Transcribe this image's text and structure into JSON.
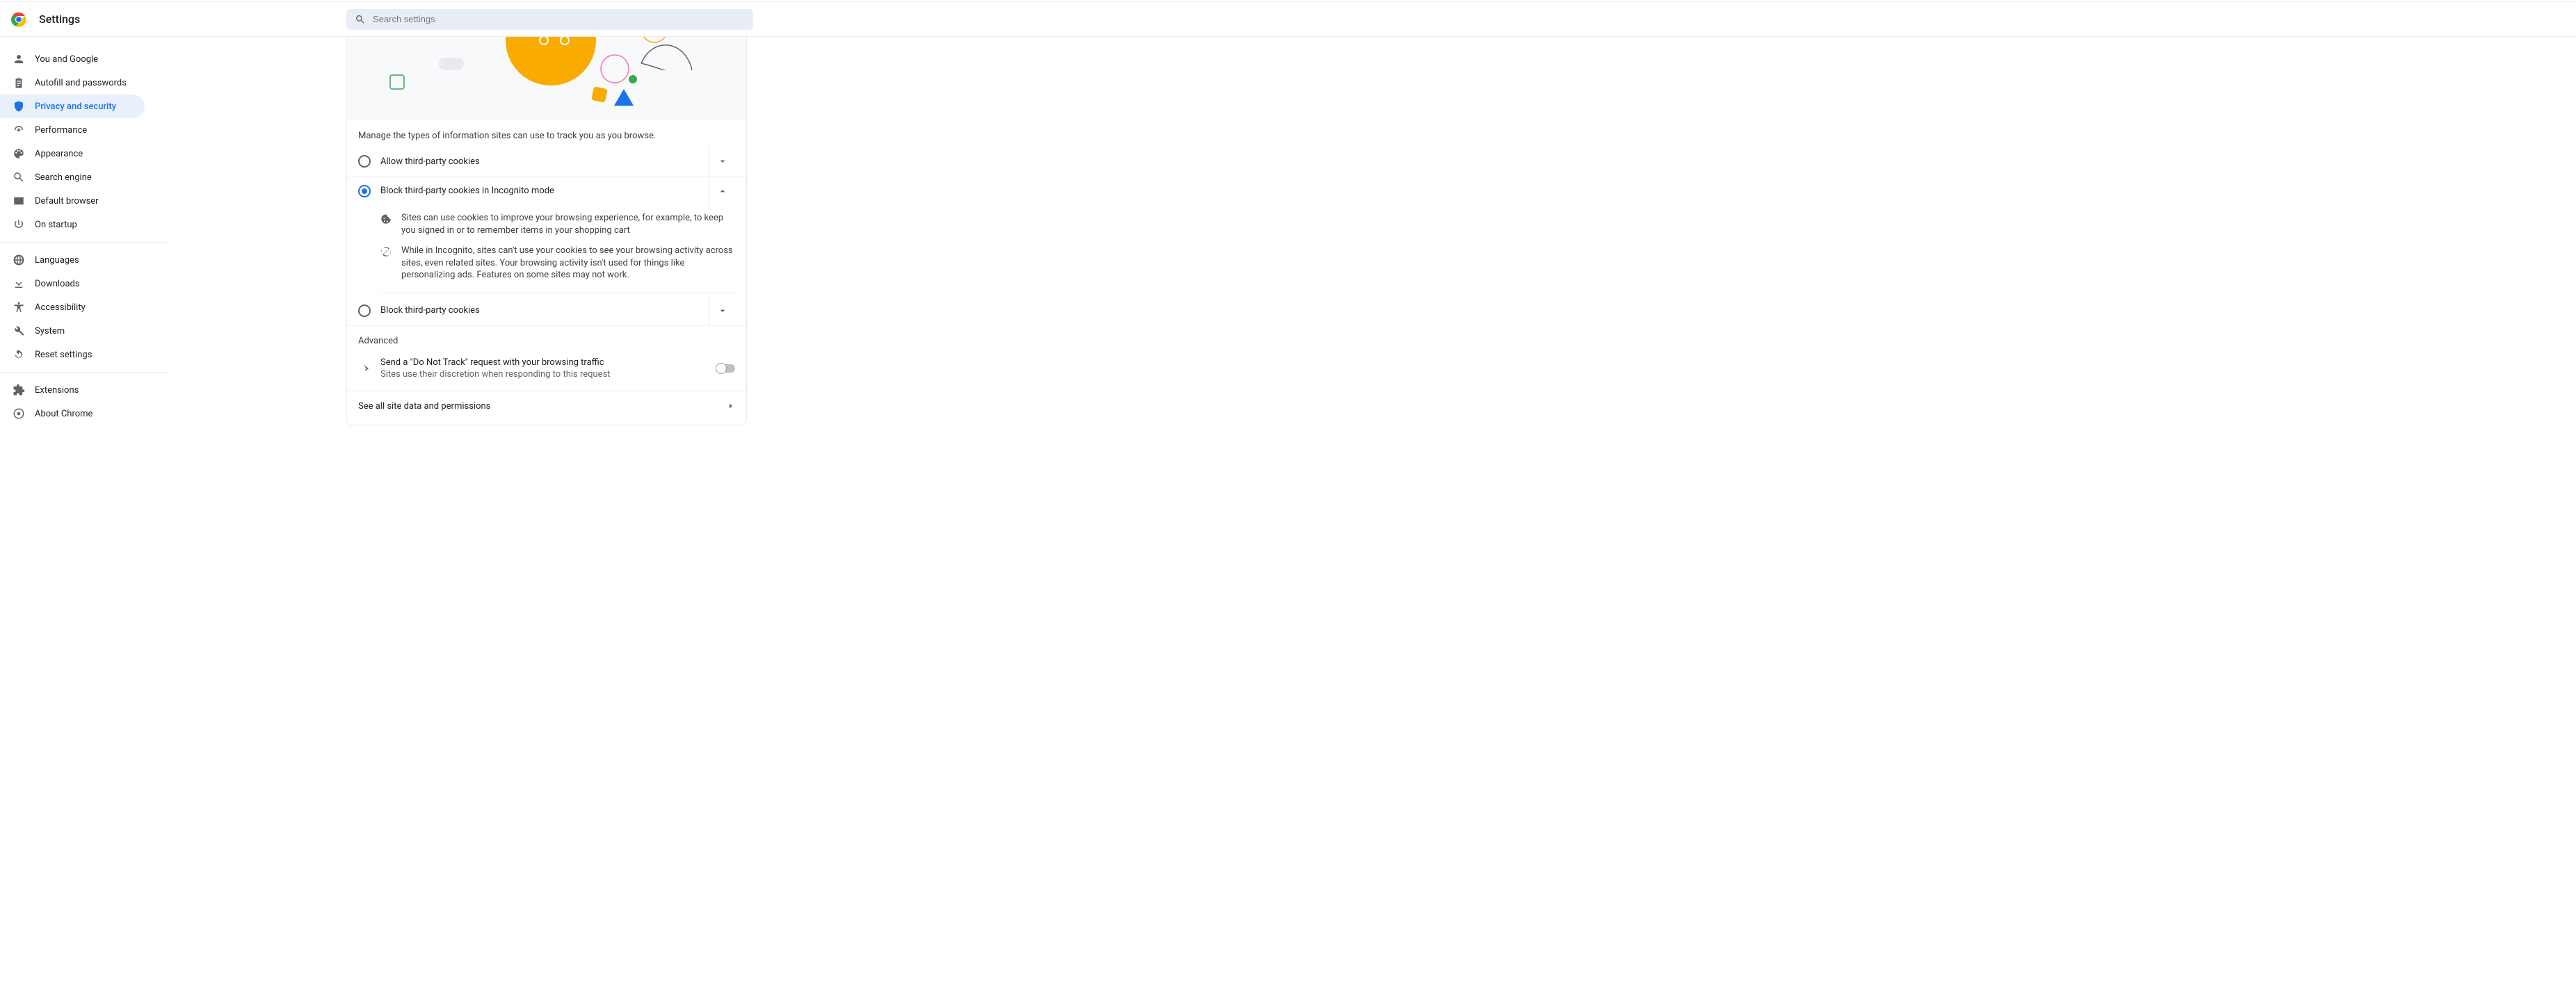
{
  "header": {
    "title": "Settings"
  },
  "search": {
    "placeholder": "Search settings"
  },
  "sidebar": {
    "groups": [
      [
        {
          "label": "You and Google",
          "icon": "person"
        },
        {
          "label": "Autofill and passwords",
          "icon": "clipboard"
        },
        {
          "label": "Privacy and security",
          "icon": "shield",
          "active": true
        },
        {
          "label": "Performance",
          "icon": "gauge"
        },
        {
          "label": "Appearance",
          "icon": "palette"
        },
        {
          "label": "Search engine",
          "icon": "search"
        },
        {
          "label": "Default browser",
          "icon": "browser"
        },
        {
          "label": "On startup",
          "icon": "power"
        }
      ],
      [
        {
          "label": "Languages",
          "icon": "globe"
        },
        {
          "label": "Downloads",
          "icon": "download"
        },
        {
          "label": "Accessibility",
          "icon": "a11y"
        },
        {
          "label": "System",
          "icon": "wrench"
        },
        {
          "label": "Reset settings",
          "icon": "reset"
        }
      ],
      [
        {
          "label": "Extensions",
          "icon": "puzzle",
          "external": true
        },
        {
          "label": "About Chrome",
          "icon": "chrome"
        }
      ]
    ]
  },
  "main": {
    "desc": "Manage the types of information sites can use to track you as you browse.",
    "options": [
      {
        "label": "Allow third-party cookies",
        "selected": false,
        "expanded": false
      },
      {
        "label": "Block third-party cookies in Incognito mode",
        "selected": true,
        "expanded": true
      },
      {
        "label": "Block third-party cookies",
        "selected": false,
        "expanded": false
      }
    ],
    "details": [
      {
        "icon": "cookie",
        "text": "Sites can use cookies to improve your browsing experience, for example, to keep you signed in or to remember items in your shopping cart"
      },
      {
        "icon": "block",
        "text": "While in Incognito, sites can't use your cookies to see your browsing activity across sites, even related sites. Your browsing activity isn't used for things like personalizing ads. Features on some sites may not work."
      }
    ],
    "advanced_label": "Advanced",
    "dnt": {
      "title": "Send a \"Do Not Track\" request with your browsing traffic",
      "sub": "Sites use their discretion when responding to this request",
      "on": false
    },
    "link": "See all site data and permissions"
  }
}
